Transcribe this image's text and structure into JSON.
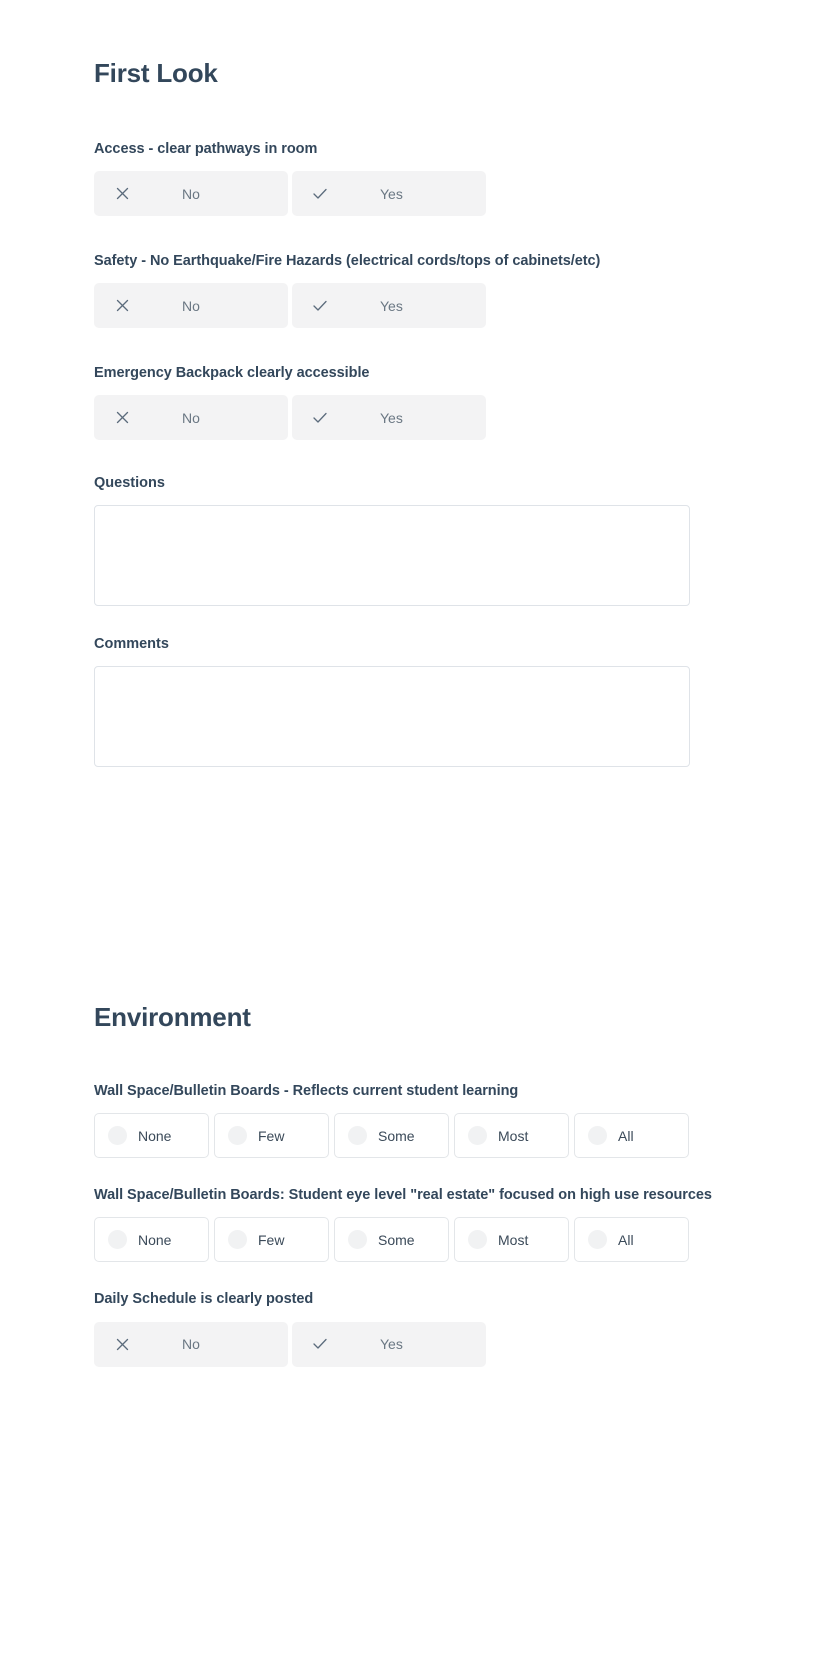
{
  "sections": [
    {
      "title": "First Look",
      "fields": [
        {
          "type": "yesno",
          "label": "Access - clear pathways in room",
          "options": [
            {
              "icon": "x-icon",
              "label": "No"
            },
            {
              "icon": "check-icon",
              "label": "Yes"
            }
          ]
        },
        {
          "type": "yesno",
          "label": "Safety - No Earthquake/Fire Hazards (electrical cords/tops of cabinets/etc)",
          "options": [
            {
              "icon": "x-icon",
              "label": "No"
            },
            {
              "icon": "check-icon",
              "label": "Yes"
            }
          ]
        },
        {
          "type": "yesno",
          "label": "Emergency Backpack clearly accessible",
          "options": [
            {
              "icon": "x-icon",
              "label": "No"
            },
            {
              "icon": "check-icon",
              "label": "Yes"
            }
          ]
        },
        {
          "type": "textarea",
          "label": "Questions",
          "value": "",
          "placeholder": ""
        },
        {
          "type": "textarea",
          "label": "Comments",
          "value": "",
          "placeholder": ""
        }
      ]
    },
    {
      "title": "Environment",
      "fields": [
        {
          "type": "scale",
          "label": "Wall Space/Bulletin Boards - Reflects current student learning",
          "options": [
            {
              "label": "None"
            },
            {
              "label": "Few"
            },
            {
              "label": "Some"
            },
            {
              "label": "Most"
            },
            {
              "label": "All"
            }
          ]
        },
        {
          "type": "scale",
          "label": "Wall Space/Bulletin Boards: Student eye level \"real estate\" focused on high use resources",
          "options": [
            {
              "label": "None"
            },
            {
              "label": "Few"
            },
            {
              "label": "Some"
            },
            {
              "label": "Most"
            },
            {
              "label": "All"
            }
          ]
        },
        {
          "type": "yesno",
          "label": "Daily Schedule is clearly posted",
          "options": [
            {
              "icon": "x-icon",
              "label": "No"
            },
            {
              "icon": "check-icon",
              "label": "Yes"
            }
          ]
        }
      ]
    }
  ],
  "colors": {
    "heading": "#33475b",
    "label": "#33475b",
    "toggle_bg": "#f3f3f4",
    "toggle_text": "#6a7783",
    "option_border": "#e3e6e9",
    "radio_fill": "#f1f2f3",
    "textarea_border": "#dfe3e8",
    "page_bg": "#ffffff"
  }
}
